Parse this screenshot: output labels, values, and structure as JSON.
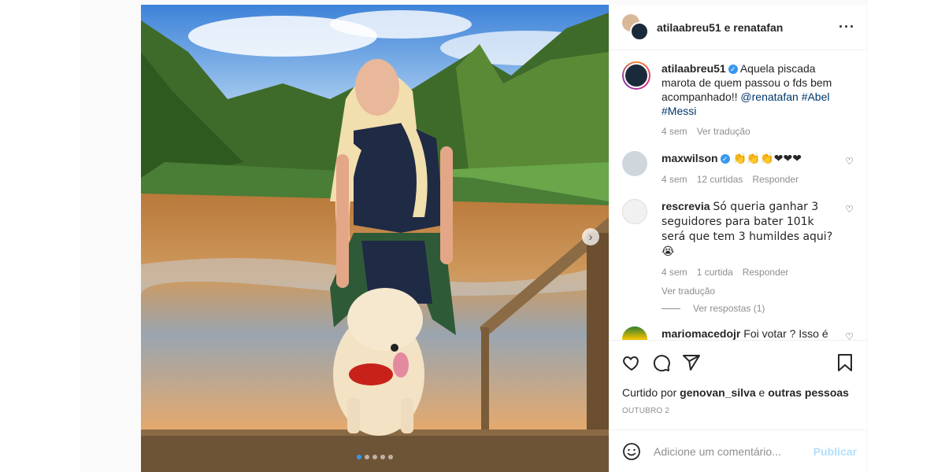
{
  "post": {
    "header_users": "atilaabreu51 e renatafan",
    "more_icon": "more-horizontal-icon",
    "carousel_total": 5,
    "carousel_active": 1
  },
  "caption": {
    "username": "atilaabreu51",
    "text": "Aquela piscada marota de quem passou o fds bem acompanhado!!",
    "mention": "@renatafan",
    "hashtag1": "#Abel",
    "hashtag2": "#Messi",
    "time": "4 sem",
    "translate": "Ver tradução"
  },
  "comments": [
    {
      "username": "maxwilson",
      "text": "👏👏👏❤❤❤",
      "time": "4 sem",
      "likes": "12 curtidas",
      "reply": "Responder"
    },
    {
      "username": "rescrevia",
      "text": "Só queria ganhar 3 seguidores para bater 101k será que tem 3 humildes aqui?😭",
      "time": "4 sem",
      "likes": "1 curtida",
      "reply": "Responder",
      "translate": "Ver tradução",
      "view_replies": "Ver respostas (1)"
    },
    {
      "username": "mariomacedojr",
      "text": "Foi votar ? Isso é"
    }
  ],
  "likes": {
    "prefix": "Curtido por",
    "user": "genovan_silva",
    "joiner": "e",
    "others": "outras pessoas"
  },
  "date": "OUTUBRO 2",
  "composer": {
    "placeholder": "Adicione um comentário...",
    "post_label": "Publicar"
  },
  "colors": {
    "accent": "#3897f0",
    "link": "#00376b",
    "muted": "#8e8e8e",
    "post_disabled": "#b2dffc"
  }
}
